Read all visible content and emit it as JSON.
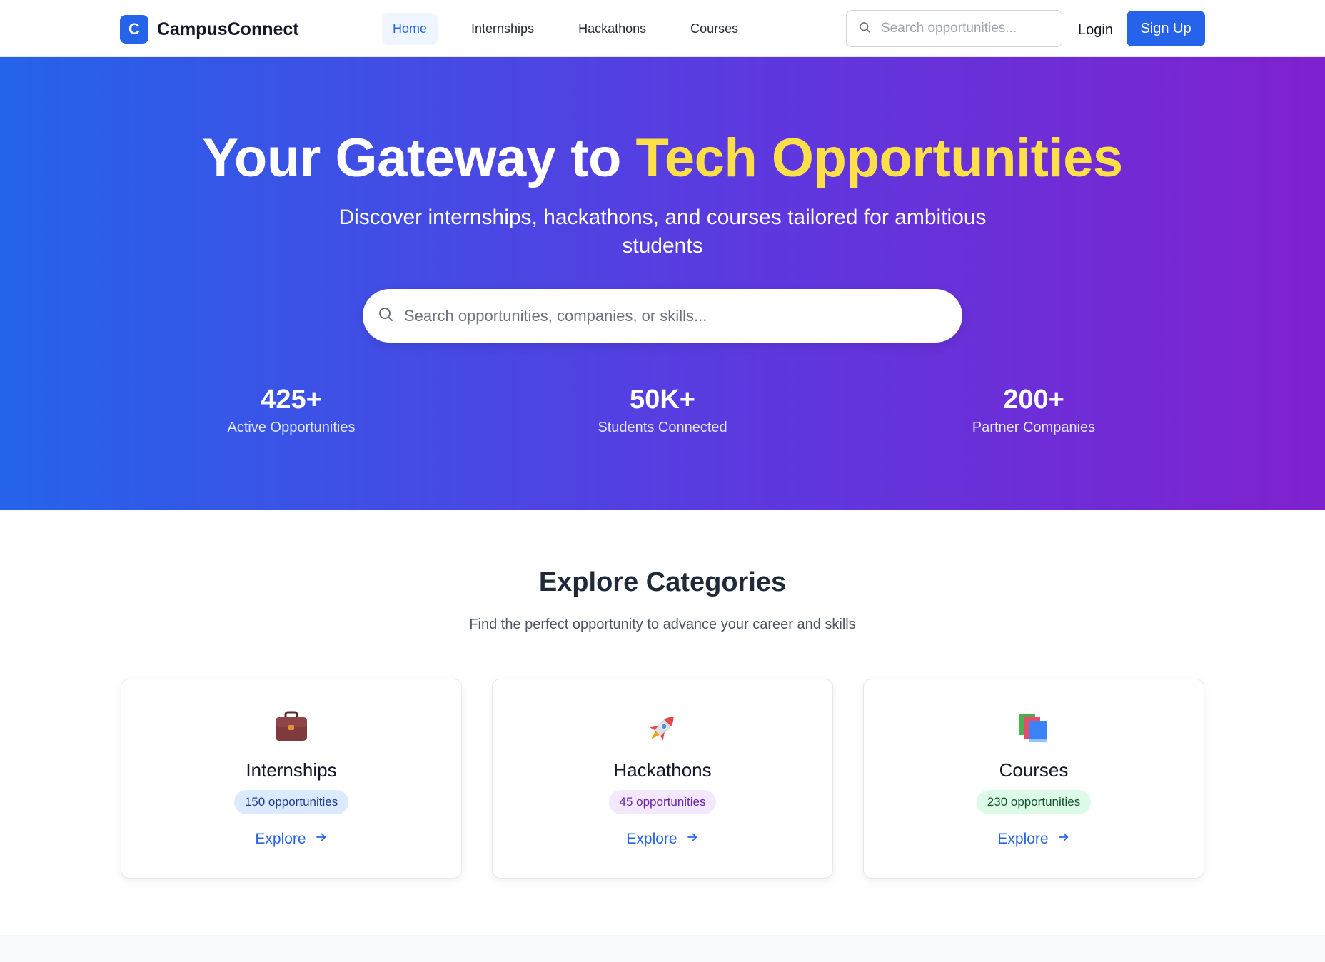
{
  "colors": {
    "accent": "#2563eb",
    "hero_highlight": "#fde047",
    "hero_gradient_start": "#2563eb",
    "hero_gradient_end": "#7e22ce"
  },
  "navbar": {
    "logo_letter": "C",
    "brand": "CampusConnect",
    "links": [
      "Home",
      "Internships",
      "Hackathons",
      "Courses"
    ],
    "active_link": "Home",
    "search_placeholder": "Search opportunities...",
    "login_label": "Login",
    "signup_label": "Sign Up"
  },
  "hero": {
    "title_part1": "Your Gateway to",
    "title_highlight": "Tech Opportunities",
    "subtitle": "Discover internships, hackathons, and courses tailored for ambitious students",
    "search_placeholder": "Search opportunities, companies, or skills...",
    "stats": [
      {
        "value": "425+",
        "label": "Active Opportunities"
      },
      {
        "value": "50K+",
        "label": "Students Connected"
      },
      {
        "value": "200+",
        "label": "Partner Companies"
      }
    ]
  },
  "categories": {
    "title": "Explore Categories",
    "subtitle": "Find the perfect opportunity to advance your career and skills",
    "items": [
      {
        "icon": "briefcase-icon",
        "title": "Internships",
        "count": "150 opportunities",
        "explore": "Explore"
      },
      {
        "icon": "rocket-icon",
        "title": "Hackathons",
        "count": "45 opportunities",
        "explore": "Explore"
      },
      {
        "icon": "books-icon",
        "title": "Courses",
        "count": "230 opportunities",
        "explore": "Explore"
      }
    ]
  }
}
